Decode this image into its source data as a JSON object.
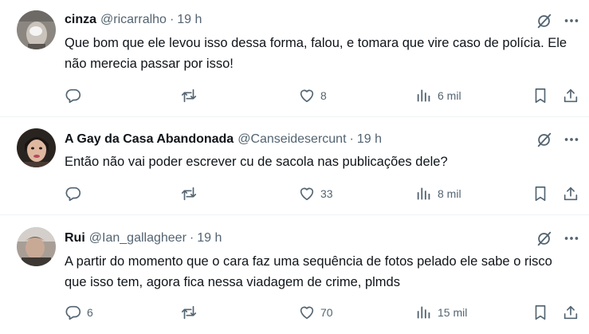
{
  "tweets": [
    {
      "name": "cinza",
      "handle": "@ricarralho",
      "dot": "·",
      "time": "19 h",
      "text": "Que bom que ele levou isso dessa forma, falou, e tomara que vire caso de polícia. Ele não merecia passar por isso!",
      "replies": "",
      "retweets": "",
      "likes": "8",
      "views": "6 mil"
    },
    {
      "name": "A Gay da Casa Abandonada",
      "handle": "@Canseidesercunt",
      "dot": "·",
      "time": "19 h",
      "text": "Então não vai poder escrever cu de sacola nas publicações dele?",
      "replies": "",
      "retweets": "",
      "likes": "33",
      "views": "8 mil"
    },
    {
      "name": "Rui",
      "handle": "@Ian_gallagheer",
      "dot": "·",
      "time": "19 h",
      "text": "A partir do momento que o cara faz uma sequência de fotos pelado ele sabe o risco que isso tem, agora fica nessa viadagem de crime, plmds",
      "replies": "6",
      "retweets": "",
      "likes": "70",
      "views": "15 mil"
    }
  ],
  "icons": {
    "avatar": "avatar",
    "grok": "grok-icon",
    "more": "more-icon",
    "reply": "reply-icon",
    "retweet": "retweet-icon",
    "like": "like-icon",
    "views": "views-icon",
    "bookmark": "bookmark-icon",
    "share": "share-icon"
  },
  "colors": {
    "text": "#0f1419",
    "secondary": "#536471",
    "divider": "#eff3f4"
  }
}
